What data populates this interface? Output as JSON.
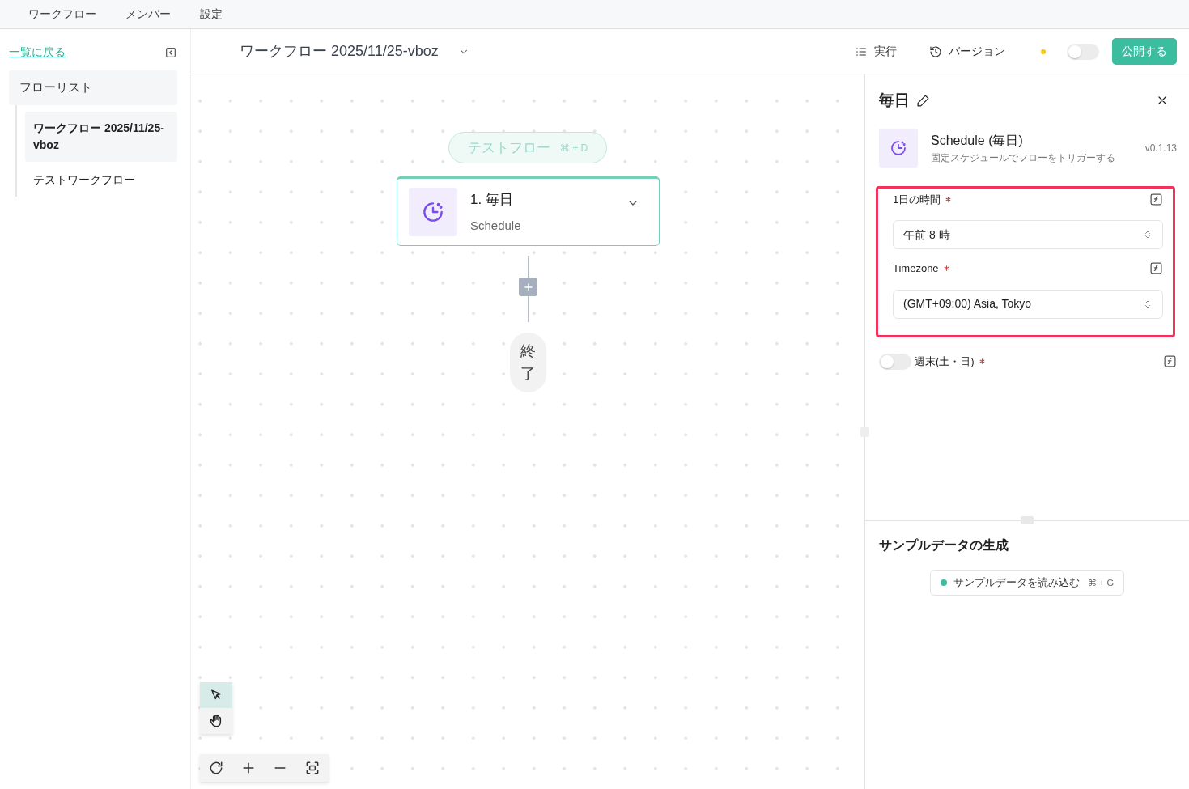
{
  "top_nav": [
    {
      "label": "ワークフロー"
    },
    {
      "label": "メンバー"
    },
    {
      "label": "設定"
    }
  ],
  "sidebar": {
    "back_link": "一覧に戻る",
    "list_title": "フローリスト",
    "items": [
      {
        "label": "ワークフロー 2025/11/25-vboz",
        "selected": true
      },
      {
        "label": "テストワークフロー",
        "selected": false
      }
    ]
  },
  "header": {
    "title": "ワークフロー 2025/11/25-vboz",
    "run_label": "実行",
    "version_label": "バージョン",
    "publish_toggle": {
      "on": false
    },
    "publish_button": "公開する"
  },
  "canvas": {
    "test_flow": {
      "label": "テストフロー",
      "shortcut": "⌘ + D"
    },
    "node": {
      "title": "1. 毎日",
      "subtitle": "Schedule",
      "expanded": false
    },
    "end_label": "終了",
    "tools": [
      {
        "kind": "select",
        "selected": true
      },
      {
        "kind": "hand",
        "selected": false
      }
    ]
  },
  "panel": {
    "title": "毎日",
    "plugin_name": "Schedule (毎日)",
    "description": "固定スケジュールでフローをトリガーする",
    "version": "v0.1.13",
    "fields": [
      {
        "kind": "select",
        "label": "1日の時間",
        "required": true,
        "value": "午前 8 時",
        "highlighted": true
      },
      {
        "kind": "select",
        "label": "Timezone",
        "required": true,
        "value": "(GMT+09:00) Asia, Tokyo",
        "highlighted": true
      },
      {
        "kind": "toggle",
        "label": "週末(土・日)",
        "required": true,
        "on": false,
        "highlighted": false
      }
    ]
  },
  "sample": {
    "title": "サンプルデータの生成",
    "button_label": "サンプルデータを読み込む",
    "shortcut": "⌘ + G"
  }
}
